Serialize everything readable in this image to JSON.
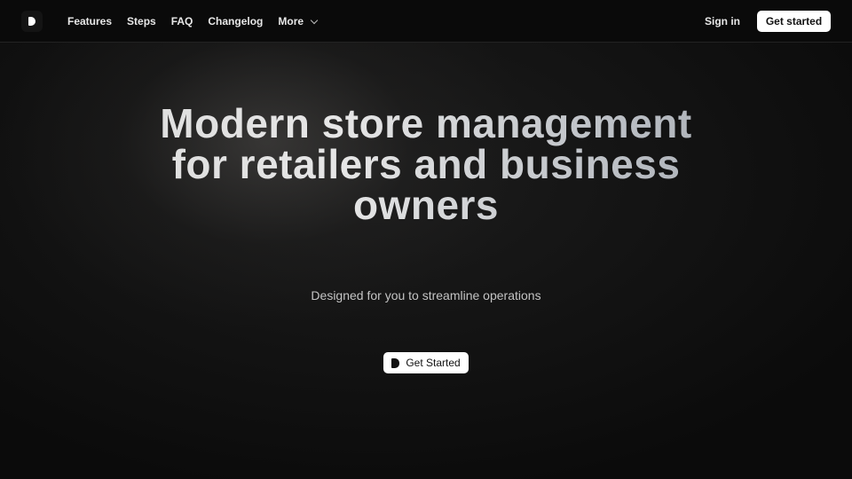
{
  "navbar": {
    "logo_icon": "brand-d-logo-icon",
    "links": [
      {
        "label": "Features"
      },
      {
        "label": "Steps"
      },
      {
        "label": "FAQ"
      },
      {
        "label": "Changelog"
      },
      {
        "label": "More",
        "icon": "chevron-down-icon"
      }
    ],
    "sign_in_label": "Sign in",
    "get_started_label": "Get started"
  },
  "hero": {
    "title_lines": [
      "Modern store management",
      "for retailers and business",
      "owners"
    ],
    "subtitle": "Designed for you to streamline operations",
    "cta_label": "Get Started",
    "cta_icon": "brand-d-logo-icon"
  },
  "colors": {
    "background": "#0b0b0b",
    "button_bg": "#ffffff",
    "button_text": "#111111",
    "nav_text": "#e8e8e8"
  }
}
